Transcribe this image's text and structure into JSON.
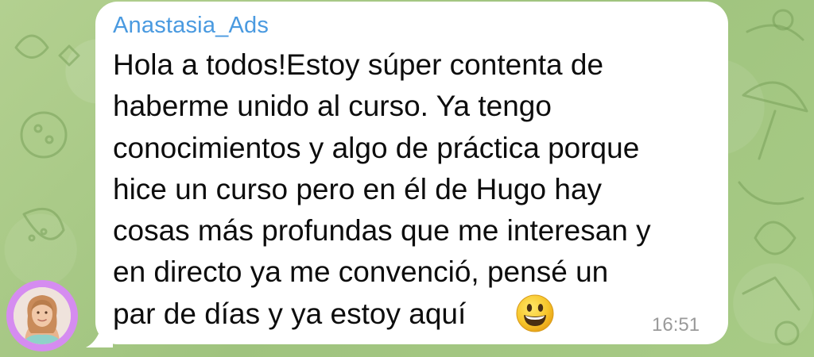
{
  "message": {
    "sender": "Anastasia_Ads",
    "text": "Hola a todos!Estoy súper contenta de\nhaberme unido al curso. Ya tengo\nconocimientos y algo de práctica porque\nhice un curso pero en él de Hugo hay\ncosas más profundas que me interesan y\nen directo ya me convenció, pensé un\npar de días y ya estoy aquí",
    "emoji": "grinning-face",
    "time": "16:51"
  },
  "colors": {
    "background": "#a9c98a",
    "bubble": "#ffffff",
    "sender_name": "#4a9ae0",
    "avatar_ring": "#d58cf0",
    "time": "#9a9a9a"
  },
  "icons": {
    "emoji": "grinning-face-icon",
    "avatar": "user-avatar"
  }
}
